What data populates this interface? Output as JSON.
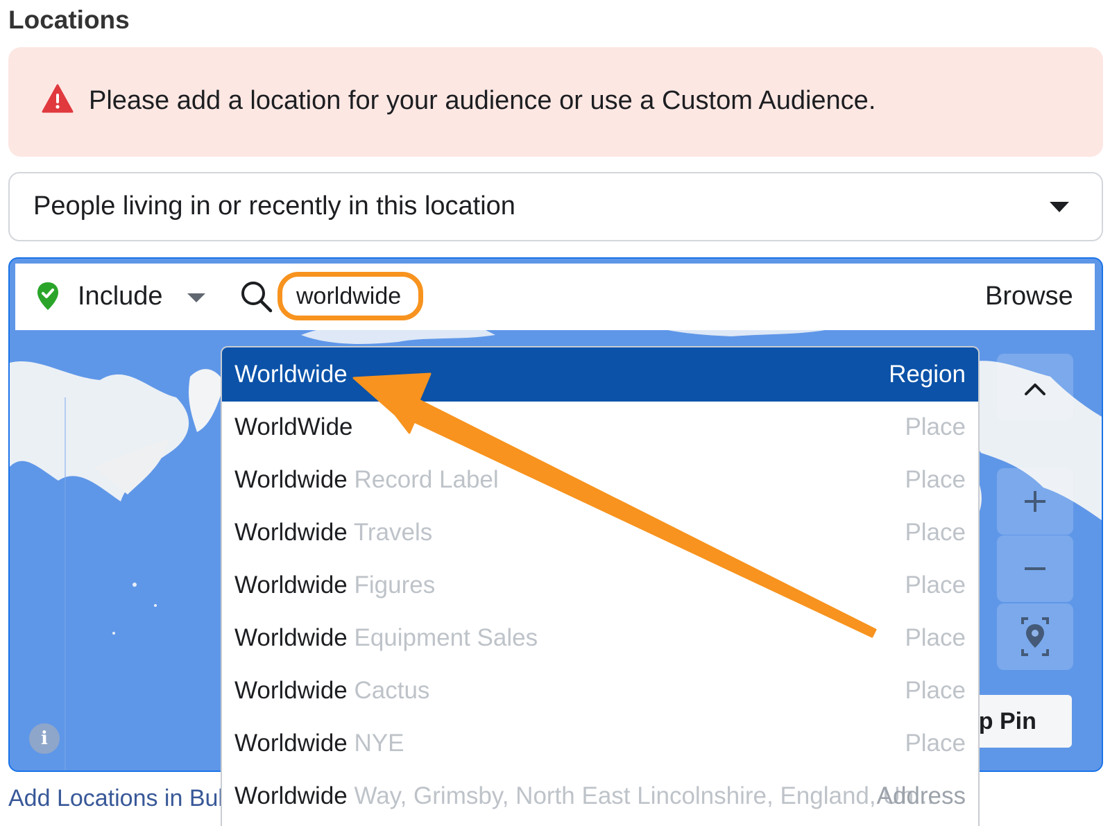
{
  "section_title": "Locations",
  "alert": {
    "icon": "warning-icon",
    "text": "Please add a location for your audience or use a Custom Audience.",
    "color": "#e0393e"
  },
  "location_type": {
    "selected": "People living in or recently in this location"
  },
  "search_bar": {
    "include_label": "Include",
    "search_value": "worldwide",
    "browse_label": "Browse"
  },
  "map": {
    "drop_pin_label": "op Pin",
    "info_label": "i"
  },
  "bulk_link": "Add Locations in Bul",
  "results": [
    {
      "name": "Worldwide",
      "detail": "",
      "type": "Region",
      "selected": true
    },
    {
      "name": "WorldWide",
      "detail": "",
      "type": "Place"
    },
    {
      "name": "Worldwide",
      "detail": "Record Label",
      "type": "Place"
    },
    {
      "name": "Worldwide",
      "detail": "Travels",
      "type": "Place"
    },
    {
      "name": "Worldwide",
      "detail": "Figures",
      "type": "Place"
    },
    {
      "name": "Worldwide",
      "detail": "Equipment Sales",
      "type": "Place"
    },
    {
      "name": "Worldwide",
      "detail": "Cactus",
      "type": "Place"
    },
    {
      "name": "Worldwide",
      "detail": "NYE",
      "type": "Place"
    },
    {
      "name": "Worldwide",
      "detail": "Way, Grimsby, North East Lincolnshire, England, Un...",
      "type": "Address"
    }
  ],
  "colors": {
    "highlight": "#f7931e",
    "selected_row": "#0b52a8",
    "map_water": "#5f97e8",
    "include_green": "#2aa52a"
  }
}
